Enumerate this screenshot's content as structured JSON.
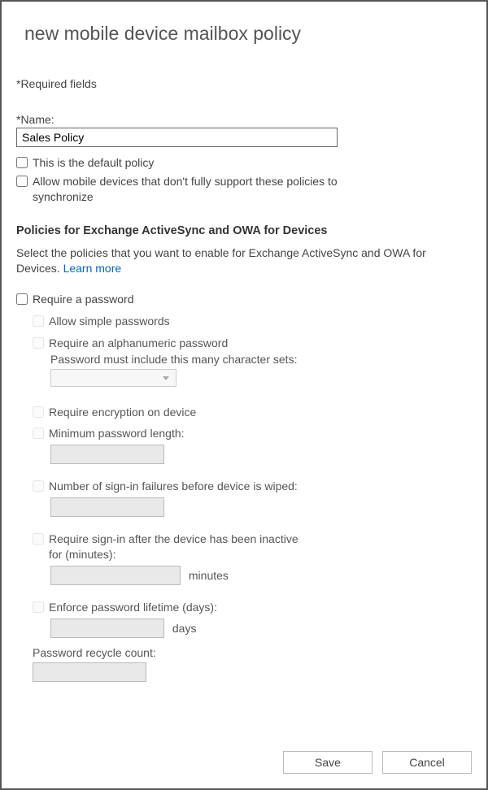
{
  "title": "new mobile device mailbox policy",
  "required_note": "*Required fields",
  "name_label": "*Name:",
  "name_value": "Sales Policy",
  "default_policy_label": "This is the default policy",
  "allow_nonprovisionable_label": "Allow mobile devices that don't fully support these policies to synchronize",
  "section_heading": "Policies for Exchange ActiveSync and OWA for Devices",
  "section_desc_prefix": "Select the policies that you want to enable for Exchange ActiveSync and OWA for Devices. ",
  "learn_more": "Learn more",
  "require_password_label": "Require a password",
  "allow_simple_label": "Allow simple passwords",
  "require_alnum_label": "Require an alphanumeric password",
  "charsets_label": "Password must include this many character sets:",
  "require_encryption_label": "Require encryption on device",
  "min_len_label": "Minimum password length:",
  "failures_label": "Number of sign-in failures before device is wiped:",
  "inactive_label": "Require sign-in after the device has been inactive for (minutes):",
  "inactive_unit": "minutes",
  "lifetime_label": "Enforce password lifetime (days):",
  "lifetime_unit": "days",
  "recycle_label": "Password recycle count:",
  "buttons": {
    "save": "Save",
    "cancel": "Cancel"
  }
}
